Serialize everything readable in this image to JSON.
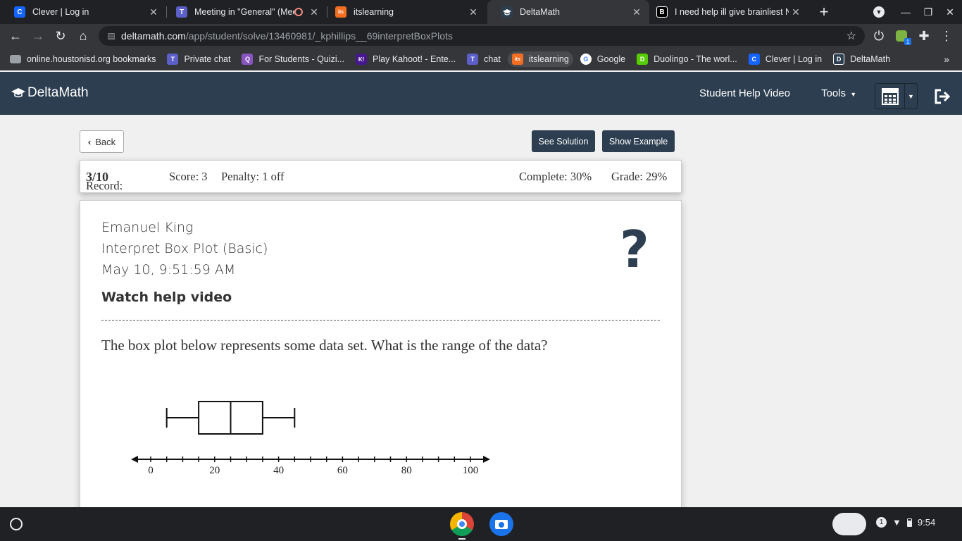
{
  "browser": {
    "tabs": [
      {
        "title": "Clever | Log in",
        "favicon": "clever-icon",
        "color": "#1464ff",
        "glyph": "C"
      },
      {
        "title": "Meeting in \"General\" (Meet",
        "favicon": "teams-icon",
        "color": "#5b5fc7",
        "glyph": "T"
      },
      {
        "title": "itslearning",
        "favicon": "itslearning-icon",
        "color": "#f26f21",
        "glyph": "its"
      },
      {
        "title": "DeltaMath",
        "favicon": "deltamath-icon",
        "color": "#2c3e50",
        "glyph": "D"
      },
      {
        "title": "I need help ill give brainliest N",
        "favicon": "brainly-icon",
        "color": "#000000",
        "glyph": "B"
      }
    ],
    "url_host": "deltamath.com",
    "url_path": "/app/student/solve/13460981/_kphillips__69interpretBoxPlots",
    "bookmarks": [
      {
        "label": "online.houstonisd.org bookmarks",
        "icon": "folder-icon",
        "color": "#9aa0a6",
        "glyph": ""
      },
      {
        "label": "Private chat",
        "icon": "teams-icon",
        "color": "#5b5fc7",
        "glyph": "T"
      },
      {
        "label": "For Students - Quizi...",
        "icon": "quizizz-icon",
        "color": "#8854c0",
        "glyph": "Q"
      },
      {
        "label": "Play Kahoot! - Ente...",
        "icon": "kahoot-icon",
        "color": "#46178f",
        "glyph": "K!"
      },
      {
        "label": "chat",
        "icon": "teams-icon",
        "color": "#5b5fc7",
        "glyph": "T"
      },
      {
        "label": "itslearning",
        "icon": "itslearning-icon",
        "color": "#f26f21",
        "glyph": "its"
      },
      {
        "label": "Google",
        "icon": "google-icon",
        "color": "#ffffff",
        "glyph": "G"
      },
      {
        "label": "Duolingo - The worl...",
        "icon": "duolingo-icon",
        "color": "#58cc02",
        "glyph": "D"
      },
      {
        "label": "Clever | Log in",
        "icon": "clever-icon",
        "color": "#1464ff",
        "glyph": "C"
      },
      {
        "label": "DeltaMath",
        "icon": "deltamath-icon",
        "color": "#2c3e50",
        "glyph": "D"
      }
    ]
  },
  "navbar": {
    "brand": "DeltaMath",
    "help_video": "Student Help Video",
    "tools": "Tools"
  },
  "actions": {
    "back": "Back",
    "see_solution": "See Solution",
    "show_example": "Show Example"
  },
  "record": {
    "record_label": "Record:",
    "record_value": "3/10",
    "score": "Score: 3",
    "penalty": "Penalty: 1 off",
    "complete": "Complete: 30%",
    "grade": "Grade: 29%"
  },
  "problem": {
    "student": "Emanuel King",
    "skill": "Interpret Box Plot (Basic)",
    "timestamp": "May 10, 9:51:59 AM",
    "help_link": "Watch help video",
    "question": "The box plot below represents some data set. What is the range of the data?"
  },
  "chart_data": {
    "type": "boxplot",
    "min": 5,
    "q1": 15,
    "median": 25,
    "q3": 35,
    "max": 45,
    "axis_range": [
      0,
      100
    ],
    "tick_labels": [
      "0",
      "20",
      "40",
      "60",
      "80",
      "100"
    ],
    "minor_tick_step": 5
  },
  "taskbar": {
    "time": "9:54",
    "notification_count": "1"
  }
}
